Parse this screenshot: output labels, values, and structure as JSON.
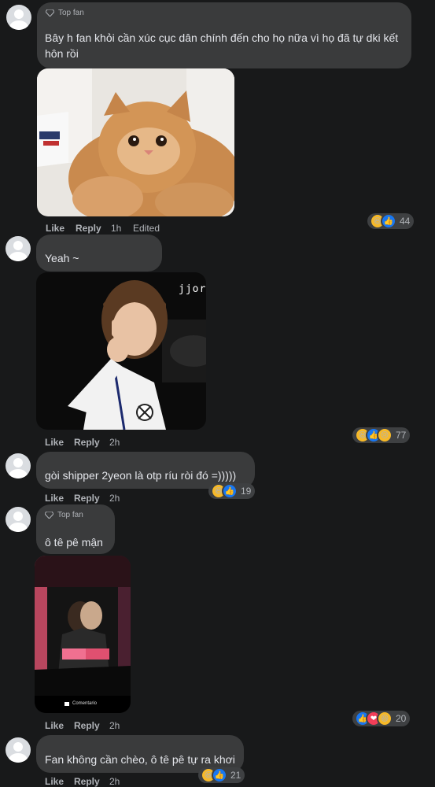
{
  "comments": [
    {
      "badge": "Top fan",
      "text": "Bây h fan khỏi cần xúc cục dân chính đến cho họ nữa vì họ đã tự dki kết hôn rồi",
      "like": "Like",
      "reply": "Reply",
      "time": "1h",
      "edited": "Edited",
      "reactions": {
        "count": "44",
        "icons": [
          "haha-icon",
          "like-icon"
        ]
      }
    },
    {
      "text": "Yeah ~",
      "like": "Like",
      "reply": "Reply",
      "time": "2h",
      "reactions": {
        "count": "77",
        "icons": [
          "haha-icon",
          "like-icon",
          "sad-icon"
        ]
      },
      "media_overlay": "jjoru"
    },
    {
      "text": "gòi shipper 2yeon là otp ríu ròi đó =)))))",
      "like": "Like",
      "reply": "Reply",
      "time": "2h",
      "reactions": {
        "count": "19",
        "icons": [
          "haha-icon",
          "like-icon"
        ]
      }
    },
    {
      "badge": "Top fan",
      "text": "ô tê pê mận",
      "like": "Like",
      "reply": "Reply",
      "time": "2h",
      "reactions": {
        "count": "20",
        "icons": [
          "like-icon",
          "love-icon",
          "haha-icon"
        ]
      },
      "media_caption": "Comentario"
    },
    {
      "text": "Fan không cần chèo, ô tê pê tự ra khơi",
      "like": "Like",
      "reply": "Reply",
      "time": "2h",
      "reactions": {
        "count": "21",
        "icons": [
          "haha-icon",
          "like-icon"
        ]
      }
    }
  ]
}
